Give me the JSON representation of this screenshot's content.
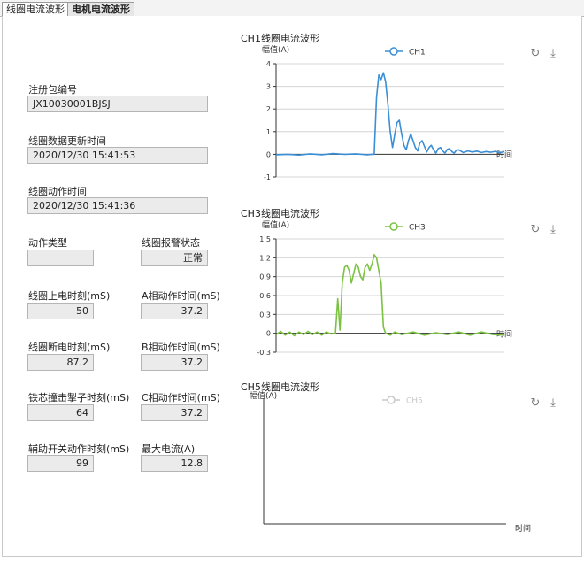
{
  "tabs": [
    {
      "label": "线圈电流波形",
      "active": true
    },
    {
      "label": "电机电流波形",
      "active": false
    }
  ],
  "fields": {
    "reg_no": {
      "label": "注册包编号",
      "value": "JX10030001BJSJ"
    },
    "data_time": {
      "label": "线圈数据更新时间",
      "value": "2020/12/30 15:41:53"
    },
    "action_time": {
      "label": "线圈动作时间",
      "value": "2020/12/30 15:41:36"
    },
    "action_type": {
      "label": "动作类型",
      "value": ""
    },
    "alarm_state": {
      "label": "线圈报警状态",
      "value": "正常"
    },
    "power_on_time": {
      "label": "线圈上电时刻(mS)",
      "value": "50"
    },
    "a_action": {
      "label": "A相动作时间(mS)",
      "value": "37.2"
    },
    "power_off_time": {
      "label": "线圈断电时刻(mS)",
      "value": "87.2"
    },
    "b_action": {
      "label": "B相动作时间(mS)",
      "value": "37.2"
    },
    "core_strike": {
      "label": "铁芯撞击掣子时刻(mS)",
      "value": "64"
    },
    "c_action": {
      "label": "C相动作时间(mS)",
      "value": "37.2"
    },
    "aux_switch": {
      "label": "辅助开关动作时刻(mS)",
      "value": "99"
    },
    "max_current": {
      "label": "最大电流(A)",
      "value": "12.8"
    }
  },
  "icons": {
    "refresh": "refresh-icon",
    "download": "download-icon"
  },
  "colors": {
    "ch1": "#3b8fd6",
    "ch3": "#7cc242",
    "ch5": "#c8c8c8"
  },
  "chart_data": [
    {
      "type": "line",
      "title": "CH1线圈电流波形",
      "ylabel": "幅值(A)",
      "xlabel": "时间",
      "legend": "CH1",
      "legend_placement": "top",
      "ylim": [
        -1,
        4
      ],
      "yticks": [
        -1,
        0,
        1,
        2,
        3,
        4
      ],
      "xlim": [
        0,
        100
      ],
      "series": [
        {
          "name": "CH1",
          "x": [
            0,
            5,
            10,
            15,
            20,
            25,
            30,
            35,
            40,
            42,
            43,
            44,
            45,
            46,
            47,
            48,
            49,
            50,
            51,
            52,
            53,
            54,
            55,
            56,
            57,
            58,
            59,
            60,
            61,
            62,
            63,
            64,
            65,
            66,
            67,
            68,
            69,
            70,
            71,
            72,
            73,
            74,
            75,
            76,
            77,
            78,
            79,
            80,
            82,
            84,
            86,
            88,
            90,
            92,
            94,
            96,
            98,
            100
          ],
          "y": [
            -0.02,
            0.0,
            -0.03,
            0.02,
            -0.02,
            0.03,
            0.0,
            0.02,
            -0.02,
            0.0,
            0.0,
            2.5,
            3.5,
            3.3,
            3.6,
            3.2,
            2.2,
            1.0,
            0.3,
            0.9,
            1.4,
            1.5,
            0.9,
            0.4,
            0.2,
            0.6,
            0.9,
            0.6,
            0.3,
            0.15,
            0.5,
            0.6,
            0.35,
            0.1,
            0.3,
            0.4,
            0.2,
            0.05,
            0.25,
            0.3,
            0.15,
            0.05,
            0.22,
            0.25,
            0.12,
            0.05,
            0.18,
            0.2,
            0.08,
            0.15,
            0.1,
            0.14,
            0.08,
            0.12,
            0.09,
            0.13,
            0.07,
            0.12
          ]
        }
      ]
    },
    {
      "type": "line",
      "title": "CH3线圈电流波形",
      "ylabel": "幅值(A)",
      "xlabel": "时间",
      "legend": "CH3",
      "legend_placement": "top",
      "ylim": [
        -0.3,
        1.5
      ],
      "yticks": [
        -0.3,
        0,
        0.3,
        0.6,
        0.9,
        1.2,
        1.5
      ],
      "xlim": [
        0,
        100
      ],
      "series": [
        {
          "name": "CH3",
          "x": [
            0,
            2,
            4,
            6,
            8,
            10,
            12,
            14,
            16,
            18,
            20,
            22,
            24,
            26,
            27,
            28,
            29,
            30,
            31,
            32,
            33,
            34,
            35,
            36,
            37,
            38,
            39,
            40,
            41,
            42,
            43,
            44,
            45,
            46,
            47,
            48,
            50,
            52,
            55,
            60,
            65,
            70,
            75,
            80,
            85,
            90,
            95,
            100
          ],
          "y": [
            -0.02,
            0.03,
            -0.03,
            0.02,
            -0.04,
            0.02,
            -0.02,
            0.03,
            -0.02,
            0.02,
            -0.03,
            0.02,
            -0.01,
            0.0,
            0.55,
            0.05,
            0.8,
            1.05,
            1.08,
            1.0,
            0.8,
            0.95,
            1.1,
            1.05,
            0.9,
            0.85,
            1.05,
            1.1,
            1.0,
            1.1,
            1.25,
            1.2,
            1.0,
            0.8,
            0.1,
            0.0,
            -0.03,
            0.02,
            -0.02,
            0.02,
            -0.03,
            0.01,
            -0.02,
            0.02,
            -0.03,
            0.02,
            -0.02,
            -0.03
          ]
        }
      ]
    },
    {
      "type": "line",
      "title": "CH5线圈电流波形",
      "ylabel": "幅值(A)",
      "xlabel": "时间",
      "legend": "CH5",
      "legend_placement": "top",
      "series": [
        {
          "name": "CH5",
          "x": [],
          "y": []
        }
      ]
    }
  ]
}
